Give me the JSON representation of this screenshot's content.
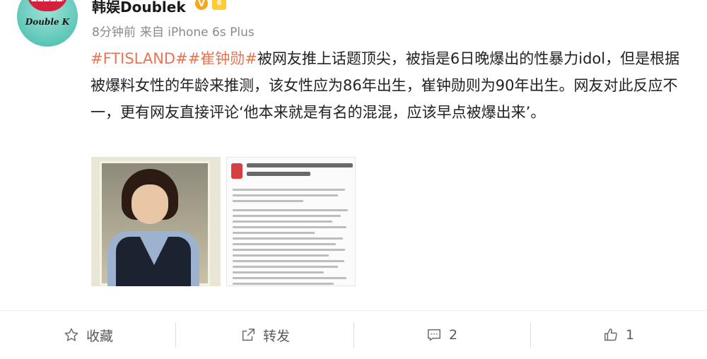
{
  "user": {
    "name": "韩娱Doublek",
    "verified_badge": "V",
    "level_badge": "6",
    "avatar_text": "Double K",
    "avatar_top_text": "NENT"
  },
  "meta": {
    "time": "8分钟前",
    "source": "来自 iPhone 6s Plus"
  },
  "post": {
    "hashtag1": "#FTISLAND#",
    "hashtag2": "#崔钟勋#",
    "body": "被网友推上话题顶尖，被指是6日晚爆出的性暴力idol，但是根据被爆料女性的年龄来推测，该女性应为86年出生，崔钟勋则为90年出生。网友对此反应不一，更有网友直接评论‘他本来就是有名的混混，应该早点被爆出来’。"
  },
  "images": {
    "doc_title_text": "[수신처] 가로는 ... 아이돌 가수이름 이 나오셨네요"
  },
  "actions": {
    "favorite": {
      "label": "收藏",
      "icon": "star-icon"
    },
    "repost": {
      "label": "转发",
      "icon": "share-icon"
    },
    "comment": {
      "label": "",
      "count": "2",
      "icon": "comment-icon"
    },
    "like": {
      "label": "",
      "count": "1",
      "icon": "thumbs-up-icon"
    }
  },
  "colors": {
    "hashtag": "#eb7350",
    "meta": "#8a8a8a",
    "action_text": "#5a5a5a",
    "verified": "#f7a71b"
  }
}
